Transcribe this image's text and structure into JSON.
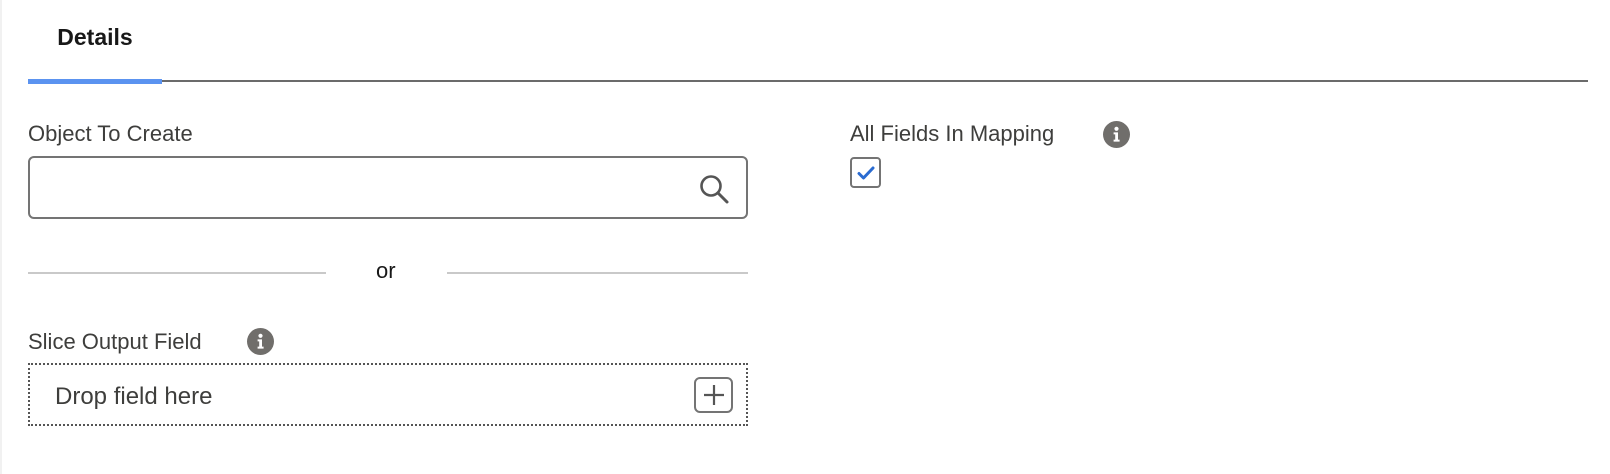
{
  "tabs": [
    {
      "label": "Details",
      "active": true
    }
  ],
  "form": {
    "object_to_create": {
      "label": "Object To Create",
      "value": "",
      "placeholder": ""
    },
    "separator_text": "or",
    "slice_output_field": {
      "label": "Slice Output Field",
      "dropzone_text": "Drop field here"
    },
    "all_fields_in_mapping": {
      "label": "All Fields In Mapping",
      "checked": true
    }
  },
  "colors": {
    "active_tab": "#5b93f0",
    "checkmark": "#2a6bd1",
    "info_icon": "#706e6b"
  },
  "icons": {
    "search": "search-icon",
    "info": "info-icon",
    "add": "plus-icon",
    "check": "check-icon"
  }
}
